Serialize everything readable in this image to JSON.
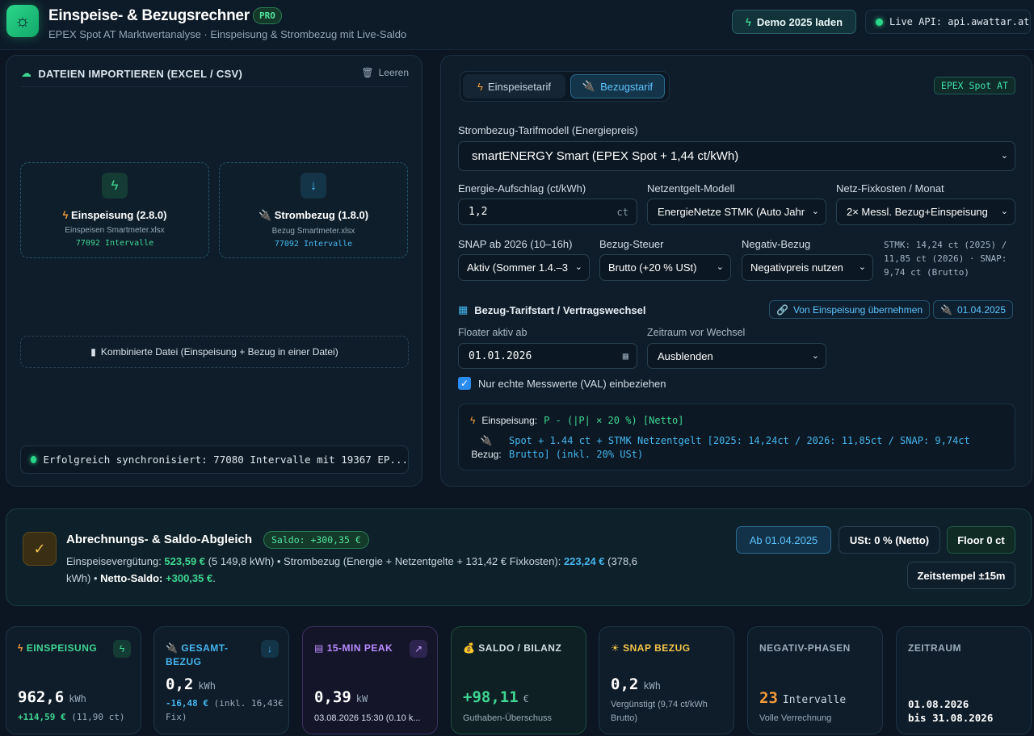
{
  "header": {
    "title": "Einspeise- & Bezugsrechner",
    "badge": "PRO",
    "subtitle": "EPEX Spot AT Marktwertanalyse · Einspeisung & Strombezug mit Live-Saldo",
    "demo_button": "Demo 2025 laden",
    "api_label": "Live API: api.awattar.at"
  },
  "import": {
    "title": "DATEIEN IMPORTIEREN (EXCEL / CSV)",
    "clear": "Leeren",
    "einspeisung": {
      "title": "Einspeisung (2.8.0)",
      "file": "Einspeisen Smartmeter.xlsx",
      "count": "77092 Intervalle"
    },
    "bezug": {
      "title": "Strombezug (1.8.0)",
      "file": "Bezug Smartmeter.xlsx",
      "count": "77092 Intervalle"
    },
    "combined": "Kombinierte Datei (Einspeisung + Bezug in einer Datei)",
    "sync": "Erfolgreich synchronisiert: 77080 Intervalle mit 19367 EP..."
  },
  "tarif": {
    "tab_einspeise": "Einspeisetarif",
    "tab_bezug": "Bezugstarif",
    "epex_badge": "EPEX Spot AT",
    "model_label": "Strombezug-Tarifmodell (Energiepreis)",
    "model_value": "smartENERGY Smart (EPEX Spot + 1,44 ct/kWh)",
    "aufschlag_label": "Energie-Aufschlag (ct/kWh)",
    "aufschlag_value": "1,2",
    "aufschlag_unit": "ct",
    "netz_label": "Netzentgelt-Modell",
    "netz_value": "EnergieNetze STMK (Auto Jahr",
    "fix_label": "Netz-Fixkosten / Monat",
    "fix_value": "2× Messl. Bezug+Einspeisung",
    "snap_label": "SNAP ab 2026 (10–16h)",
    "snap_value": "Aktiv (Sommer 1.4.–3",
    "steuer_label": "Bezug-Steuer",
    "steuer_value": "Brutto (+20 % USt)",
    "neg_label": "Negativ-Bezug",
    "neg_value": "Negativpreis nutzen",
    "info": "STMK: 14,24 ct (2025) / 11,85 ct (2026) · SNAP: 9,74 ct (Brutto)",
    "start_title": "Bezug-Tarifstart / Vertragswechsel",
    "chip_uebernehmen": "Von Einspeisung übernehmen",
    "chip_date": "01.04.2025",
    "floater_label": "Floater aktiv ab",
    "floater_value": "01.01.2026",
    "zeitraum_label": "Zeitraum vor Wechsel",
    "zeitraum_value": "Ausblenden",
    "checkbox_label": "Nur echte Messwerte (VAL) einbeziehen",
    "formula_ein_label": "Einspeisung:",
    "formula_ein_value": "P - (|P| × 20 %) [Netto]",
    "formula_bez_label": "Bezug:",
    "formula_bez_value": "Spot + 1.44 ct + STMK Netzentgelt [2025: 14,24ct / 2026: 11,85ct / SNAP: 9,74ct Brutto] (inkl. 20% USt)"
  },
  "abrechnung": {
    "title": "Abrechnungs- & Saldo-Abgleich",
    "badge": "Saldo: +300,35 €",
    "t1": "Einspeisevergütung: ",
    "v1": "523,59 €",
    "t2": " (5 149,8 kWh) • Strombezug (Energie + Netzentgelte + 131,42 € Fixkosten): ",
    "v2": "223,24 €",
    "t3": " (378,6 kWh) • ",
    "v3": "Netto-Saldo:",
    "v4": "+300,35 €",
    "t4": ".",
    "btn_date": "Ab 01.04.2025",
    "btn_ust": "USt: 0 % (Netto)",
    "btn_floor": "Floor 0 ct",
    "btn_zeit": "Zeitstempel ±15m"
  },
  "kpis": {
    "einspeisung": {
      "title": "EINSPEISUNG",
      "value": "962,6",
      "unit": "kWh",
      "sub_value": "+114,59 €",
      "sub": "(11,90 ct)"
    },
    "bezug": {
      "title": "GESAMT-BEZUG",
      "value": "0,2",
      "unit": "kWh",
      "sub_value": "-16,48 €",
      "sub": "(inkl. 16,43€ Fix)"
    },
    "peak": {
      "title": "15-MIN PEAK",
      "value": "0,39",
      "unit": "kW",
      "sub": "03.08.2026 15:30 (0.10 k..."
    },
    "saldo": {
      "title": "SALDO / BILANZ",
      "value": "+98,11",
      "unit": "€",
      "sub": "Guthaben-Überschuss"
    },
    "snap": {
      "title": "SNAP BEZUG",
      "value": "0,2",
      "unit": "kWh",
      "sub": "Vergünstigt (9,74 ct/kWh Brutto)"
    },
    "negativ": {
      "title": "NEGATIV-PHASEN",
      "value": "23",
      "unit": "Intervalle",
      "sub": "Volle Verrechnung"
    },
    "zeitraum": {
      "title": "ZEITRAUM",
      "from": "01.08.2026",
      "to": "bis 31.08.2026"
    }
  }
}
